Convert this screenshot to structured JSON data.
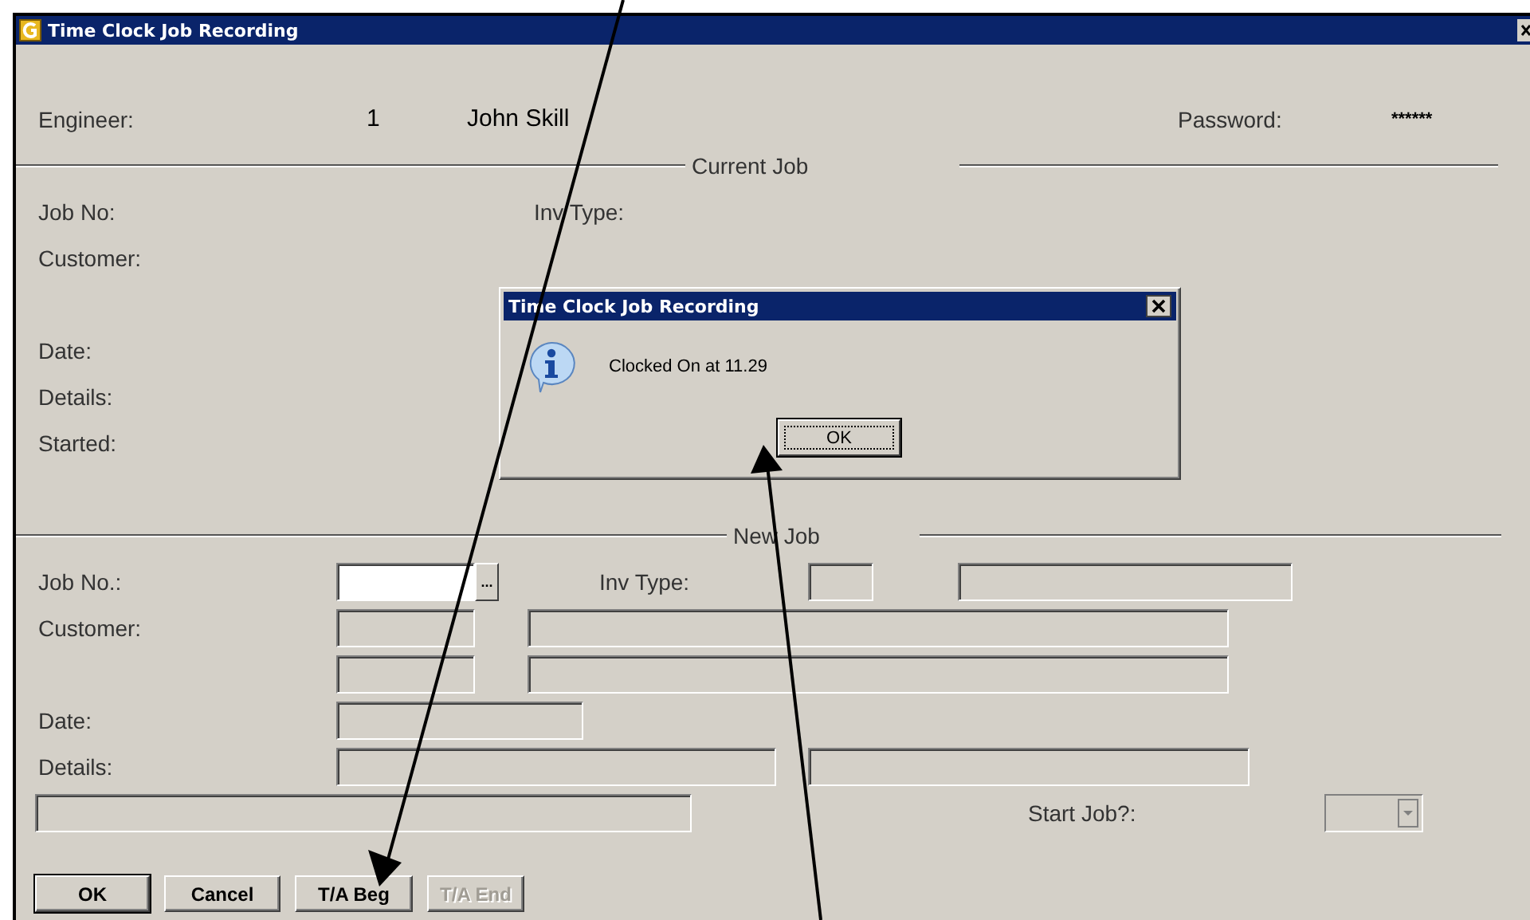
{
  "window": {
    "title": "Time Clock Job Recording"
  },
  "engineer": {
    "label": "Engineer:",
    "number": "1",
    "name": "John Skill"
  },
  "password": {
    "label": "Password:",
    "value": "******"
  },
  "current_job": {
    "heading": "Current Job",
    "job_no_label": "Job No:",
    "inv_type_label": "Inv Type:",
    "customer_label": "Customer:",
    "date_label": "Date:",
    "details_label": "Details:",
    "started_label": "Started:"
  },
  "new_job": {
    "heading": "New Job",
    "job_no_label": "Job No.:",
    "browse_button": "...",
    "inv_type_label": "Inv Type:",
    "customer_label": "Customer:",
    "date_label": "Date:",
    "details_label": "Details:",
    "start_job_label": "Start Job?:"
  },
  "buttons": [
    {
      "label": "OK",
      "disabled": false,
      "default": true
    },
    {
      "label": "Cancel",
      "disabled": false,
      "default": false
    },
    {
      "label": "T/A Beg",
      "disabled": false,
      "default": false
    },
    {
      "label": "T/A End",
      "disabled": true,
      "default": false
    }
  ],
  "message_dialog": {
    "title": "Time Clock Job Recording",
    "message": "Clocked On at 11.29",
    "button": "OK"
  }
}
